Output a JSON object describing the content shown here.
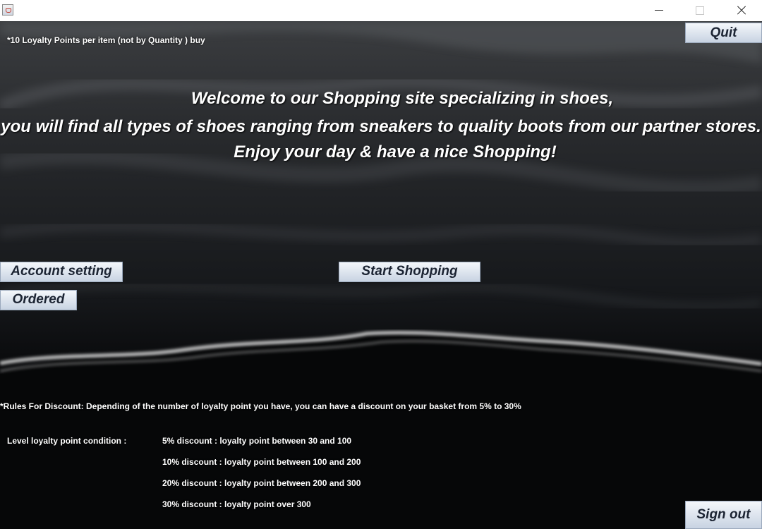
{
  "window": {
    "controls": [
      "minimize-icon",
      "maximize-icon",
      "close-icon"
    ]
  },
  "loyalty_note": "*10 Loyalty Points per item (not by Quantity ) buy",
  "buttons": {
    "quit": "Quit",
    "account_setting": "Account setting",
    "start_shopping": "Start Shopping",
    "ordered": "Ordered",
    "sign_out": "Sign out"
  },
  "welcome": {
    "line1": "Welcome to our Shopping site specializing in shoes,",
    "line2": "you will find all types of shoes ranging from sneakers to quality boots from our partner stores.",
    "line3": "Enjoy your day & have a nice Shopping!"
  },
  "discount": {
    "rules": "*Rules For Discount: Depending of the number of loyalty point you have, you can have a discount on your basket from 5% to 30%",
    "condition_label": "Level loyalty point condition :",
    "levels": [
      "5% discount : loyalty point between 30 and 100",
      "10% discount : loyalty point between 100 and 200",
      "20% discount : loyalty point between 200 and 300",
      "30% discount : loyalty point over 300"
    ]
  },
  "colors": {
    "button_top": "#f4f7fb",
    "button_bottom": "#c8d3e2",
    "button_text": "#1c2433",
    "text": "#ffffff"
  }
}
